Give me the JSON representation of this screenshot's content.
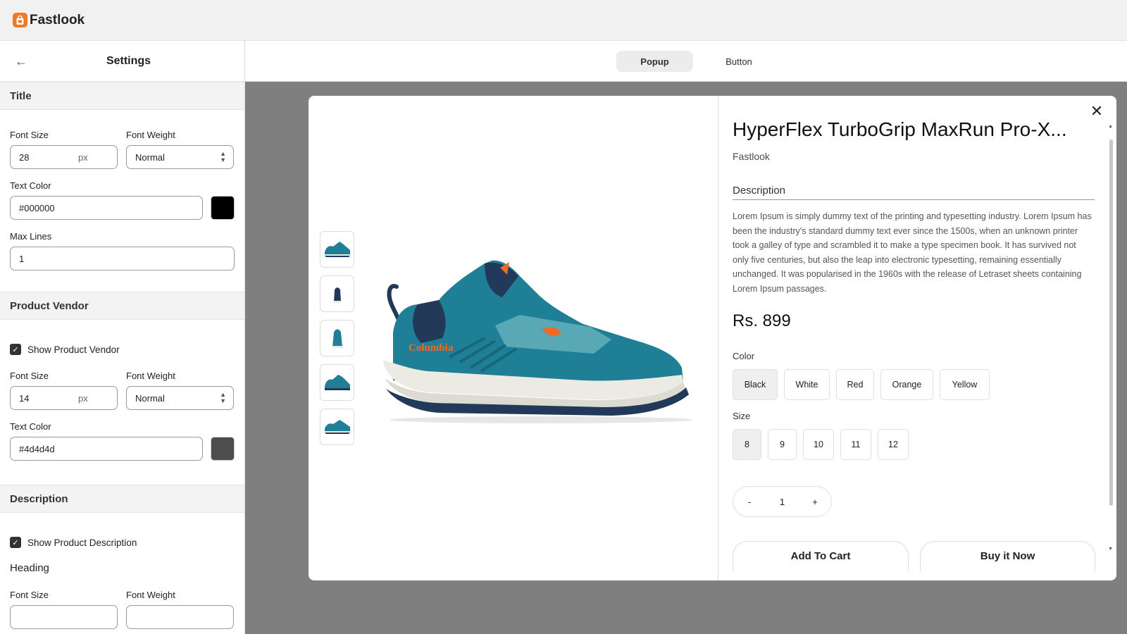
{
  "app": {
    "name": "Fastlook",
    "logo_icon": "shopping-bag-icon",
    "accent": "#f07a22"
  },
  "sidebar": {
    "title": "Settings",
    "title_section": {
      "heading": "Title",
      "font_size_label": "Font Size",
      "font_size": "28",
      "unit": "px",
      "font_weight_label": "Font Weight",
      "font_weight": "Normal",
      "text_color_label": "Text Color",
      "text_color": "#000000",
      "max_lines_label": "Max Lines",
      "max_lines": "1"
    },
    "vendor_section": {
      "heading": "Product Vendor",
      "show_label": "Show Product Vendor",
      "show_checked": true,
      "font_size_label": "Font Size",
      "font_size": "14",
      "unit": "px",
      "font_weight_label": "Font Weight",
      "font_weight": "Normal",
      "text_color_label": "Text Color",
      "text_color": "#4d4d4d"
    },
    "description_section": {
      "heading": "Description",
      "show_label": "Show Product Description",
      "show_checked": true,
      "subheading": "Heading",
      "font_size_label": "Font Size",
      "font_weight_label": "Font Weight"
    }
  },
  "tabs": [
    {
      "label": "Popup",
      "active": true
    },
    {
      "label": "Button",
      "active": false
    }
  ],
  "product": {
    "title": "HyperFlex TurboGrip MaxRun Pro-X...",
    "vendor": "Fastlook",
    "description_heading": "Description",
    "description": "Lorem Ipsum is simply dummy text of the printing and typesetting industry. Lorem Ipsum has been the industry's standard dummy text ever since the 1500s, when an unknown printer took a galley of type and scrambled it to make a type specimen book. It has survived not only five centuries, but also the leap into electronic typesetting, remaining essentially unchanged. It was popularised in the 1960s with the release of Letraset sheets containing Lorem Ipsum passages.",
    "price": "Rs. 899",
    "color_label": "Color",
    "colors": [
      "Black",
      "White",
      "Red",
      "Orange",
      "Yellow"
    ],
    "selected_color": "Black",
    "size_label": "Size",
    "sizes": [
      "8",
      "9",
      "10",
      "11",
      "12"
    ],
    "selected_size": "8",
    "qty_minus": "-",
    "qty": "1",
    "qty_plus": "+",
    "add_to_cart": "Add To Cart",
    "buy_now": "Buy it Now",
    "shoe_brand": "Columbia",
    "shoe_color": "#1f7f96",
    "close_icon": "close-icon"
  }
}
